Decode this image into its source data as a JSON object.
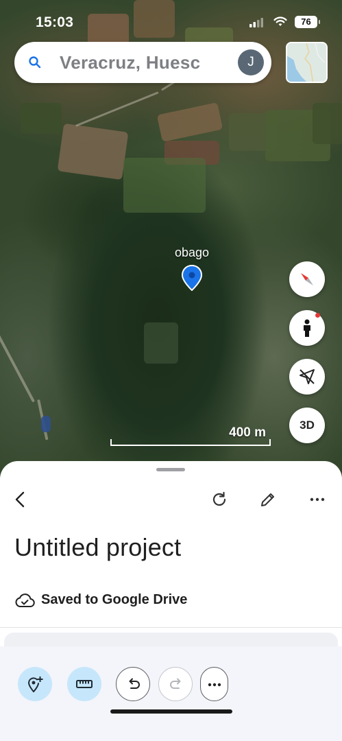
{
  "status_bar": {
    "time": "15:03",
    "battery": "76"
  },
  "search": {
    "query": "Veracruz, Huesc",
    "avatar_initial": "J"
  },
  "map": {
    "placemark_label": "obago",
    "scale_label": "400 m",
    "view_3d_label": "3D",
    "colors": {
      "pin": "#1a73e8",
      "compass_north": "#e53935"
    }
  },
  "sheet": {
    "title": "Untitled project",
    "save_status": "Saved to Google Drive"
  },
  "toolbar": {
    "buttons": [
      {
        "icon": "add-placemark-icon",
        "state": "active"
      },
      {
        "icon": "ruler-icon",
        "state": "active"
      },
      {
        "icon": "undo-icon",
        "state": "enabled"
      },
      {
        "icon": "redo-icon",
        "state": "disabled"
      },
      {
        "icon": "more-horizontal-icon",
        "state": "enabled"
      }
    ]
  }
}
